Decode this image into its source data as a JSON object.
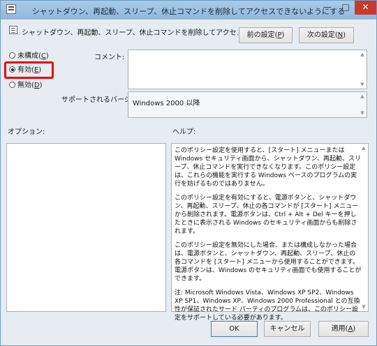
{
  "window": {
    "title": "シャットダウン、再起動、スリープ、休止コマンドを削除してアクセスできないようにする",
    "controls": {
      "minimize": "—",
      "maximize": "□",
      "close": "✕"
    }
  },
  "header": {
    "policy_name": "シャットダウン、再起動、スリープ、休止コマンドを削除してアクセスできないようにする",
    "prev_button": {
      "text": "前の設定(",
      "key": "P",
      "end": ")"
    },
    "next_button": {
      "text": "次の設定(",
      "key": "N",
      "end": ")"
    }
  },
  "options": {
    "not_configured": {
      "text": "未構成(",
      "key": "C",
      "end": ")",
      "selected": false
    },
    "enabled": {
      "text": "有効(",
      "key": "E",
      "end": ")",
      "selected": true
    },
    "disabled": {
      "text": "無効(",
      "key": "D",
      "end": ")",
      "selected": false
    }
  },
  "comment": {
    "label": "コメント:",
    "value": ""
  },
  "supported": {
    "label": "サポートされるバージョン:",
    "value": "Windows 2000 以降"
  },
  "options_section": {
    "label": "オプション:"
  },
  "help_section": {
    "label": "ヘルプ:",
    "paragraphs": [
      "このポリシー設定を使用すると、[スタート] メニューまたは Windows セキュリティ画面から、シャットダウン、再起動、スリープ、休止コマンドを実行できなくなります。このポリシー設定は、これらの機能を実行する Windows ベースのプログラムの実行を妨げるものではありません。",
      "このポリシー設定を有効にすると、電源ボタンと、シャットダウン、再起動、スリープ、休止の各コマンドが [スタート] メニューから削除されます。電源ボタンは、Ctrl + Alt + Del キーを押したときに表示される Windows のセキュリティ画面からも削除されます。",
      "このポリシー設定を無効にした場合、または構成しなかった場合は、電源ボタンと、シャットダウン、再起動、スリープ、休止の各コマンドを [スタート] メニューから使用することができます。電源ボタンは、Windows のセキュリティ画面でも使用することができます。",
      "注: Microsoft Windows Vista、Windows XP SP2、Windows XP SP1、Windows XP、Windows 2000 Professional との互換性が保証されたサード パーティのプログラムは、このポリシー設定をサポートしている必要があります。"
    ]
  },
  "footer": {
    "ok": "OK",
    "cancel": "キャンセル",
    "apply": {
      "text": "適用(",
      "key": "A",
      "end": ")"
    }
  },
  "colors": {
    "highlight": "#ee0000",
    "titlebar": "#a9cbe8",
    "close_button": "#c7392b"
  }
}
